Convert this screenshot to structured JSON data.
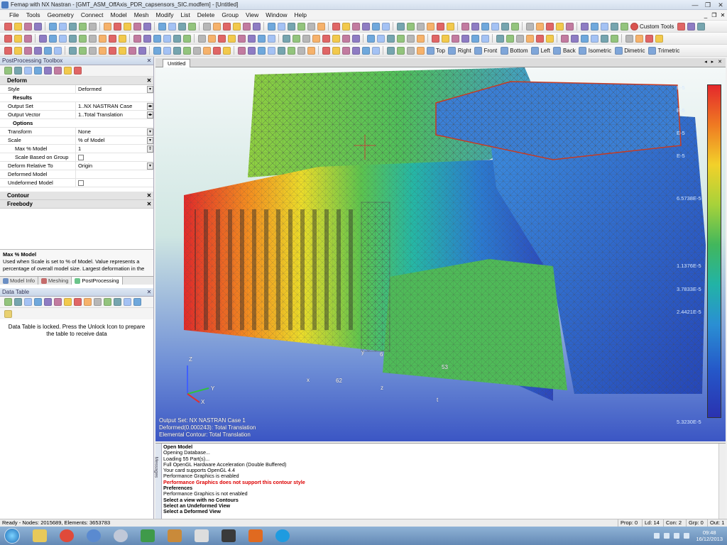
{
  "window": {
    "title": "Femap with NX Nastran - [GMT_ASM_OffAxis_PDR_capsensors_SIC.modfem] - [Untitled]",
    "minimize": "—",
    "maximize": "❐",
    "close": "✕"
  },
  "menu": [
    "File",
    "Tools",
    "Geometry",
    "Connect",
    "Model",
    "Mesh",
    "Modify",
    "List",
    "Delete",
    "Group",
    "View",
    "Window",
    "Help"
  ],
  "menu_ctrls": [
    "_",
    "❐",
    "✕"
  ],
  "toolbar": {
    "custom_tools": "Custom Tools",
    "views": [
      "Top",
      "Right",
      "Front",
      "Bottom",
      "Left",
      "Back",
      "Isometric",
      "Dimetric",
      "Trimetric"
    ]
  },
  "postprocessing_toolbox": {
    "title": "PostProcessing Toolbox",
    "close": "✕",
    "deform_header": "Deform",
    "style_label": "Style",
    "style_value": "Deformed",
    "results_group": "Results",
    "output_set_label": "Output Set",
    "output_set_value": "1..NX NASTRAN Case",
    "output_vector_label": "Output Vector",
    "output_vector_value": "1..Total Translation",
    "options_group": "Options",
    "transform_label": "Transform",
    "transform_value": "None",
    "scale_label": "Scale",
    "scale_value": "% of Model",
    "max_model_label": "Max % Model",
    "max_model_value": "1",
    "scale_based_label": "Scale Based on Group",
    "deform_relative_label": "Deform Relative To",
    "deform_relative_value": "Origin",
    "deformed_model_label": "Deformed Model",
    "undeformed_model_label": "Undeformed Model",
    "contour_header": "Contour",
    "freebody_header": "Freebody",
    "help_title": "Max % Model",
    "help_text": "Used when Scale is set to % of Model. Value represents a percentage of overall model size. Largest deformation in the"
  },
  "panel_tabs": [
    "Model Info",
    "Meshing",
    "PostProcessing"
  ],
  "data_table": {
    "title": "Data Table",
    "close": "✕",
    "locked_msg": "Data Table is locked. Press the Unlock Icon to prepare the table to receive data"
  },
  "view": {
    "tab": "Untitled",
    "nav": "◂ ▸ ✕",
    "output_set": "Output Set: NX NASTRAN Case 1",
    "deformed": "Deformed(0.000243): Total Translation",
    "contour": "Elemental Contour: Total Translation",
    "legend_labels": [
      "E-5",
      "E-5",
      "E-5",
      "E-5",
      "6.5738E-5",
      "1.1376E-5",
      "3.7833E-5",
      "2.4421E-5",
      "5.3230E-5"
    ],
    "node_labels": [
      "Z",
      "Y",
      "X",
      "y",
      "6",
      "53",
      "62",
      "z",
      "x",
      "t"
    ]
  },
  "messages": {
    "tab": "Messages",
    "lines": [
      {
        "text": "Open Model",
        "style": "bold"
      },
      {
        "text": "Opening Database...",
        "style": "normal"
      },
      {
        "text": "Loading 55 Part(s)...",
        "style": "normal"
      },
      {
        "text": "Full OpenGL Hardware Acceleration (Double Buffered)",
        "style": "normal"
      },
      {
        "text": "Your card supports OpenGL 4.4",
        "style": "normal"
      },
      {
        "text": "Performance Graphics is enabled",
        "style": "normal"
      },
      {
        "text": "Performance Graphics does not support this contour style",
        "style": "redbold"
      },
      {
        "text": "Preferences",
        "style": "bold"
      },
      {
        "text": "Performance Graphics is not enabled",
        "style": "normal"
      },
      {
        "text": "Select a view with no Contours",
        "style": "bold"
      },
      {
        "text": "Select an Undeformed View",
        "style": "bold"
      },
      {
        "text": "Select a Deformed View",
        "style": "bold"
      }
    ]
  },
  "status": {
    "text": "Ready - Nodes: 2015689, Elements: 3653783",
    "prop": "Prop: 0",
    "ld": "Ld: 14",
    "con": "Con: 2",
    "grp": "Grp: 0",
    "out": "Out: 1"
  },
  "taskbar": {
    "time": "09:48",
    "date": "16/12/2013"
  },
  "colors": {
    "accent": "#2f6fc6",
    "contour_red": "#e4282c",
    "contour_blue": "#2a32b0"
  }
}
